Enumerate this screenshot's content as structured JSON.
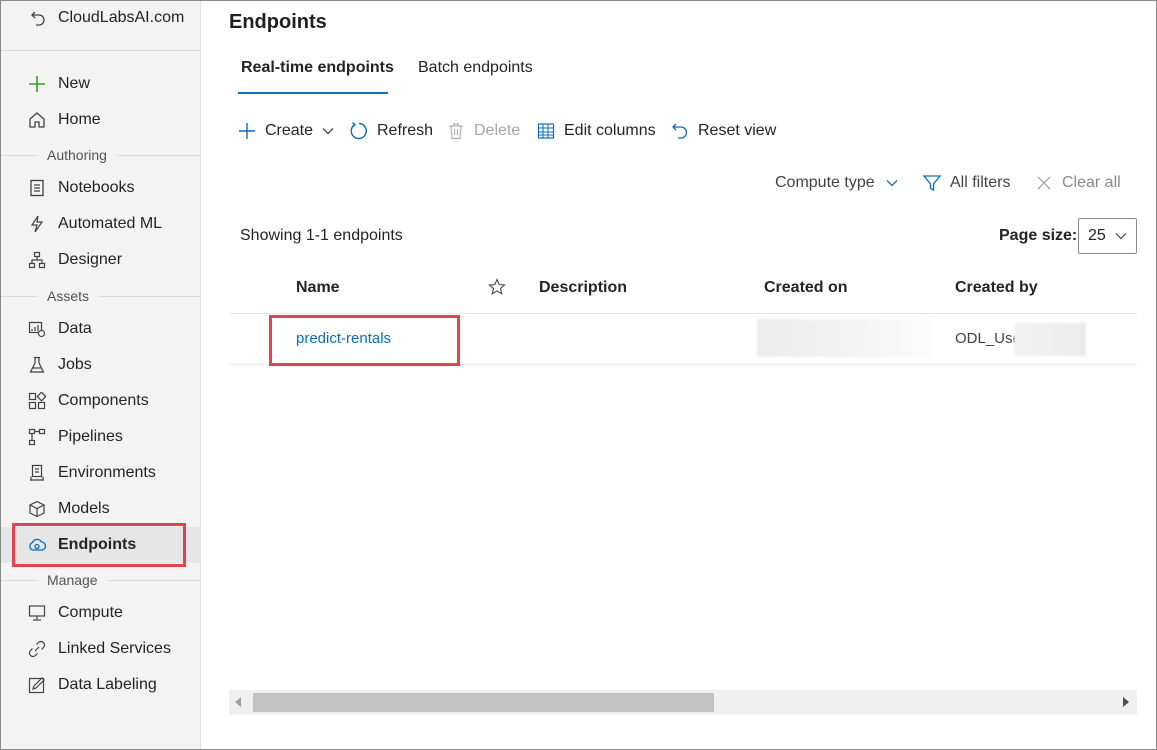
{
  "colors": {
    "accent": "#0f6cbd",
    "highlight_box": "#e5424d",
    "new_icon_green": "#3a9d23",
    "sidebar_bg": "#f3f3f3"
  },
  "sidebar": {
    "workspace": "CloudLabsAI.com",
    "top_items": [
      {
        "label": "New",
        "icon": "plus-icon"
      },
      {
        "label": "Home",
        "icon": "home-icon"
      }
    ],
    "sections": [
      {
        "label": "Authoring",
        "items": [
          {
            "label": "Notebooks",
            "icon": "notebook-icon"
          },
          {
            "label": "Automated ML",
            "icon": "automl-icon"
          },
          {
            "label": "Designer",
            "icon": "designer-icon"
          }
        ]
      },
      {
        "label": "Assets",
        "items": [
          {
            "label": "Data",
            "icon": "data-icon"
          },
          {
            "label": "Jobs",
            "icon": "flask-icon"
          },
          {
            "label": "Components",
            "icon": "components-icon"
          },
          {
            "label": "Pipelines",
            "icon": "pipeline-icon"
          },
          {
            "label": "Environments",
            "icon": "environment-icon"
          },
          {
            "label": "Models",
            "icon": "cube-icon"
          },
          {
            "label": "Endpoints",
            "icon": "cloud-endpoint-icon",
            "active": true
          }
        ]
      },
      {
        "label": "Manage",
        "items": [
          {
            "label": "Compute",
            "icon": "monitor-icon"
          },
          {
            "label": "Linked Services",
            "icon": "link-icon"
          },
          {
            "label": "Data Labeling",
            "icon": "labeling-icon"
          }
        ]
      }
    ]
  },
  "main": {
    "title": "Endpoints",
    "tabs": [
      {
        "label": "Real-time endpoints",
        "active": true
      },
      {
        "label": "Batch endpoints",
        "active": false
      }
    ],
    "toolbar": {
      "create": "Create",
      "refresh": "Refresh",
      "delete": "Delete",
      "edit_columns": "Edit columns",
      "reset_view": "Reset view"
    },
    "filters": {
      "compute_type": "Compute type",
      "all_filters": "All filters",
      "clear_all": "Clear all"
    },
    "showing": "Showing 1-1 endpoints",
    "page_size_label": "Page size:",
    "page_size_value": "25",
    "table": {
      "columns": [
        "Name",
        "Description",
        "Created on",
        "Created by"
      ],
      "rows": [
        {
          "name": "predict-rentals",
          "description": "",
          "created_on": "",
          "created_by": "ODL_User"
        }
      ]
    }
  }
}
